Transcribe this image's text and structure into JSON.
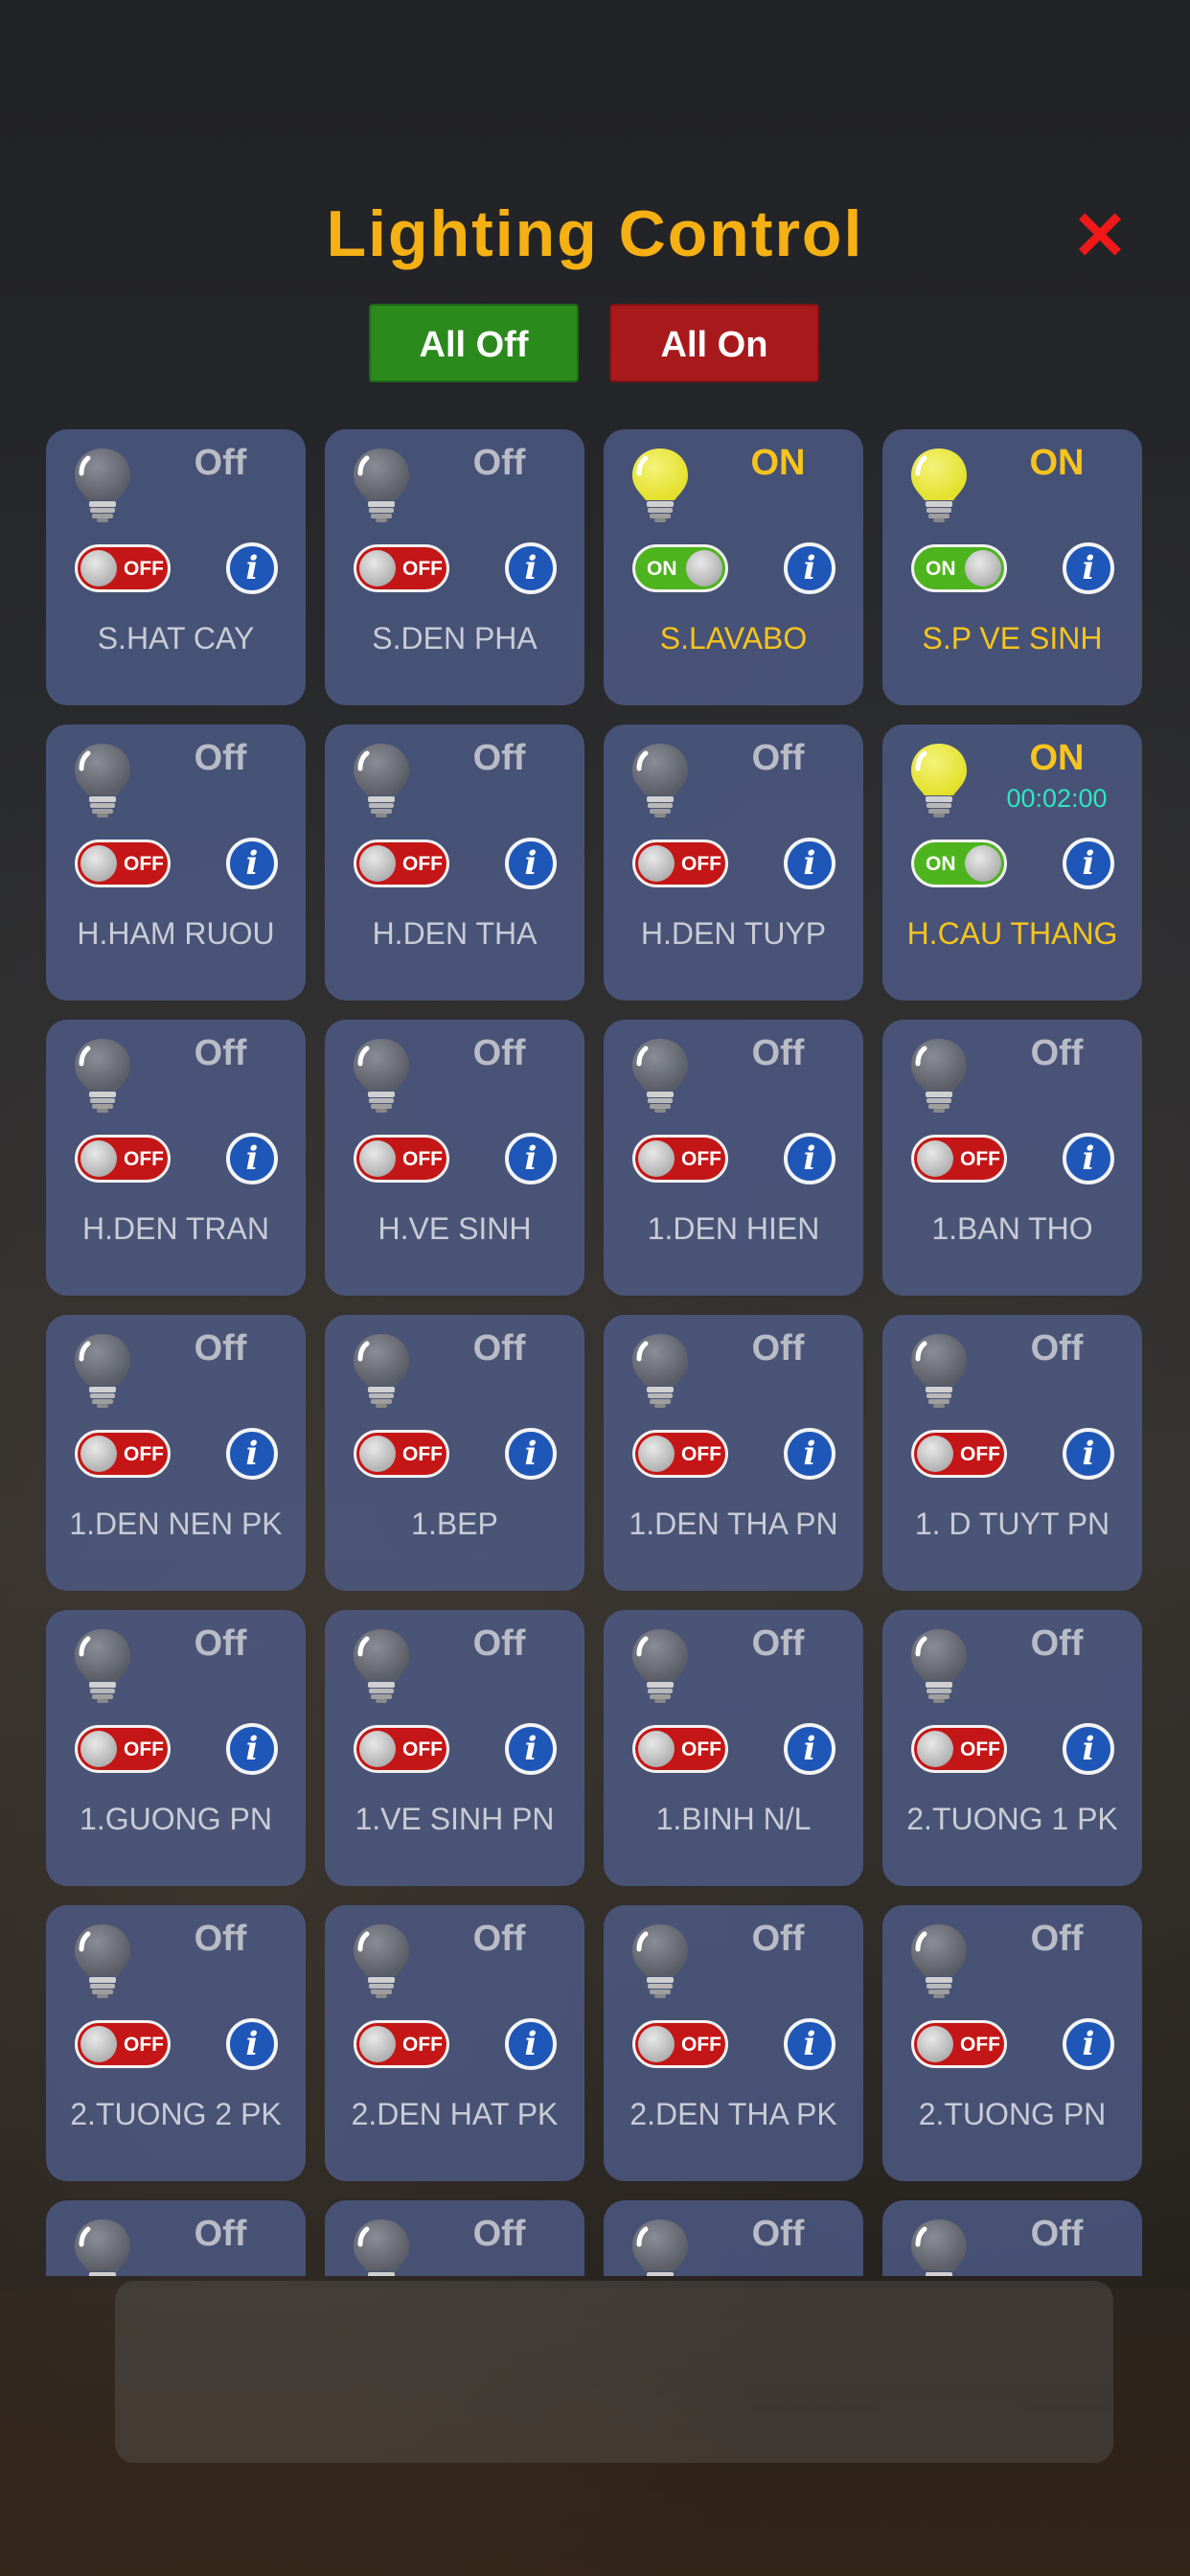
{
  "header": {
    "title": "Lighting Control",
    "close_icon": "close-icon",
    "all_off_label": "All Off",
    "all_on_label": "All On"
  },
  "colors": {
    "title": "#f5b014",
    "on_text": "#f5c41e",
    "off_text": "#b9bcc6",
    "toggle_on": "#4db41e",
    "toggle_off": "#c41616",
    "timer": "#2fe6c0",
    "info_button": "#1f57b8",
    "all_off_button": "#2a8a1c",
    "all_on_button": "#a8191c"
  },
  "toggle_labels": {
    "on": "ON",
    "off": "OFF"
  },
  "info_glyph": "i",
  "lights": [
    {
      "name": "S.HAT CAY",
      "status": "Off",
      "on": false,
      "timer": ""
    },
    {
      "name": "S.DEN PHA",
      "status": "Off",
      "on": false,
      "timer": ""
    },
    {
      "name": "S.LAVABO",
      "status": "ON",
      "on": true,
      "timer": ""
    },
    {
      "name": "S.P VE SINH",
      "status": "ON",
      "on": true,
      "timer": ""
    },
    {
      "name": "H.HAM RUOU",
      "status": "Off",
      "on": false,
      "timer": ""
    },
    {
      "name": "H.DEN THA",
      "status": "Off",
      "on": false,
      "timer": ""
    },
    {
      "name": "H.DEN TUYP",
      "status": "Off",
      "on": false,
      "timer": ""
    },
    {
      "name": "H.CAU THANG",
      "status": "ON",
      "on": true,
      "timer": "00:02:00"
    },
    {
      "name": "H.DEN TRAN",
      "status": "Off",
      "on": false,
      "timer": ""
    },
    {
      "name": "H.VE SINH",
      "status": "Off",
      "on": false,
      "timer": ""
    },
    {
      "name": "1.DEN HIEN",
      "status": "Off",
      "on": false,
      "timer": ""
    },
    {
      "name": "1.BAN THO",
      "status": "Off",
      "on": false,
      "timer": ""
    },
    {
      "name": "1.DEN NEN PK",
      "status": "Off",
      "on": false,
      "timer": ""
    },
    {
      "name": "1.BEP",
      "status": "Off",
      "on": false,
      "timer": ""
    },
    {
      "name": "1.DEN THA PN",
      "status": "Off",
      "on": false,
      "timer": ""
    },
    {
      "name": "1. D TUYT PN",
      "status": "Off",
      "on": false,
      "timer": ""
    },
    {
      "name": "1.GUONG PN",
      "status": "Off",
      "on": false,
      "timer": ""
    },
    {
      "name": "1.VE SINH PN",
      "status": "Off",
      "on": false,
      "timer": ""
    },
    {
      "name": "1.BINH N/L",
      "status": "Off",
      "on": false,
      "timer": ""
    },
    {
      "name": "2.TUONG 1 PK",
      "status": "Off",
      "on": false,
      "timer": ""
    },
    {
      "name": "2.TUONG 2 PK",
      "status": "Off",
      "on": false,
      "timer": ""
    },
    {
      "name": "2.DEN HAT PK",
      "status": "Off",
      "on": false,
      "timer": ""
    },
    {
      "name": "2.DEN THA PK",
      "status": "Off",
      "on": false,
      "timer": ""
    },
    {
      "name": "2.TUONG PN",
      "status": "Off",
      "on": false,
      "timer": ""
    },
    {
      "name": "",
      "status": "Off",
      "on": false,
      "timer": ""
    },
    {
      "name": "",
      "status": "Off",
      "on": false,
      "timer": ""
    },
    {
      "name": "",
      "status": "Off",
      "on": false,
      "timer": ""
    },
    {
      "name": "",
      "status": "Off",
      "on": false,
      "timer": ""
    }
  ]
}
